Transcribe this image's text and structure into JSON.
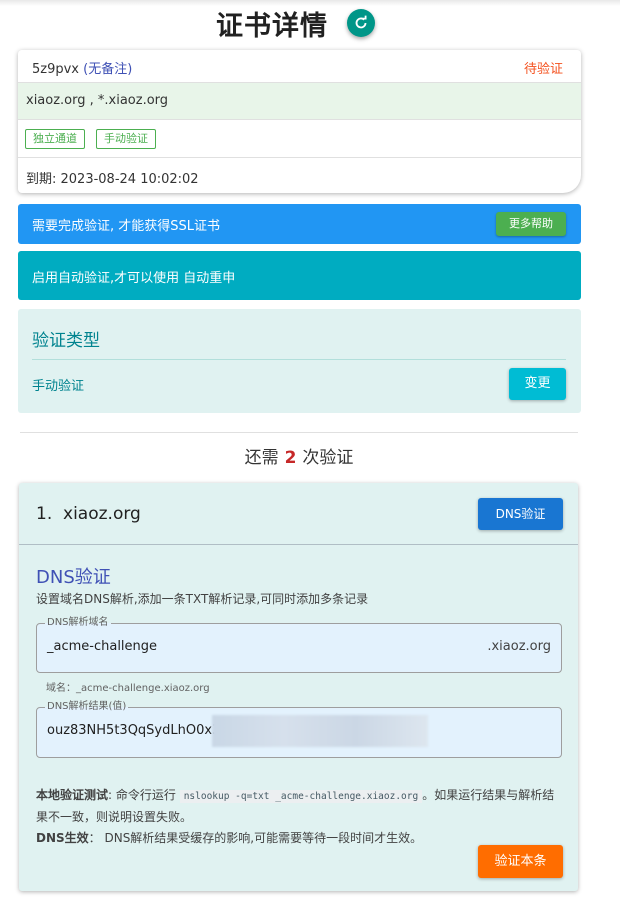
{
  "header": {
    "title": "证书详情",
    "refresh_icon": "refresh-icon",
    "accent": "#009688"
  },
  "cert": {
    "id": "5z9pvx",
    "note": "(无备注)",
    "status": "待验证",
    "status_color": "#f4511e",
    "domains": "xiaoz.org , *.xiaoz.org",
    "tags": [
      "独立通道",
      "手动验证"
    ],
    "expiry": "到期: 2023-08-24 10:02:02"
  },
  "banners": {
    "ssl_notice": "需要完成验证, 才能获得SSL证书",
    "help_button": "更多帮助",
    "auto_notice": "启用自动验证,才可以使用 自动重申"
  },
  "verify_type": {
    "heading": "验证类型",
    "value": "手动验证",
    "change_button": "变更"
  },
  "remaining": {
    "prefix": "还需",
    "count": "2",
    "suffix": "次验证"
  },
  "domain_item": {
    "title": "1.  xiaoz.org",
    "type_button": "DNS验证",
    "dns_heading": "DNS验证",
    "dns_desc": "设置域名DNS解析,添加一条TXT解析记录,可同时添加多条记录",
    "record_name_label": "DNS解析域名",
    "record_name_value": "_acme-challenge",
    "record_name_suffix": ".xiaoz.org",
    "record_name_hint": "域名：_acme-challenge.xiaoz.org",
    "record_value_label": "DNS解析结果(值)",
    "record_value_value": "ouz83NH5t3QqSydLhO0x3",
    "local_test_label": "本地验证测试",
    "local_test_pre": ": 命令行运行",
    "local_test_code": "nslookup -q=txt _acme-challenge.xiaoz.org",
    "local_test_post": "。如果运行结果与解析结果不一致，则说明设置失败。",
    "dns_effect_label": "DNS生效",
    "dns_effect_text": "：  DNS解析结果受缓存的影响,可能需要等待一段时间才生效。",
    "verify_button": "验证本条"
  }
}
